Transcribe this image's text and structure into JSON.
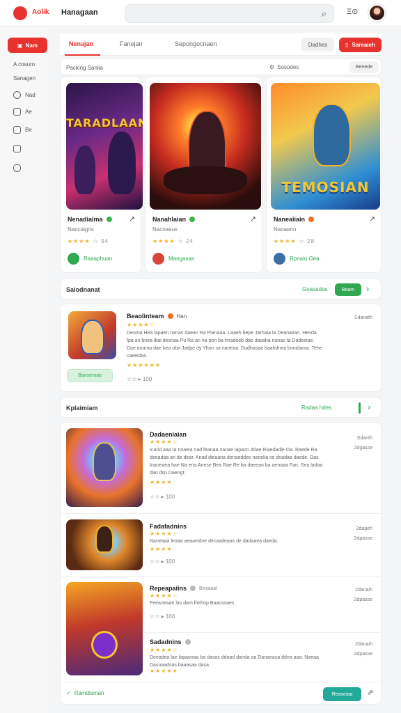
{
  "header": {
    "logo_text": "Aolik",
    "title": "Hanagaan",
    "search_placeholder": "",
    "icon_text": "Ξ⊙"
  },
  "sidebar": {
    "primary_button": "Nam",
    "items": [
      {
        "label": "A cosuro",
        "icon": "none"
      },
      {
        "label": "Sanagen",
        "icon": "none"
      },
      {
        "label": "Nad",
        "icon": "search-icon"
      },
      {
        "label": "Ae",
        "icon": "image-icon"
      },
      {
        "label": "Be",
        "icon": "calendar-icon"
      },
      {
        "label": "",
        "icon": "save-icon"
      },
      {
        "label": "",
        "icon": "shield-icon"
      }
    ]
  },
  "tabs": {
    "items": [
      "Nenajan",
      "Fanejan",
      "Sepongocnaen"
    ],
    "active": 0,
    "grey_button": "Dadhes",
    "red_button": "Sareaieh"
  },
  "featured": {
    "title": "Packing Sanlia",
    "filter_label": "Sosodes",
    "chip": "Benede",
    "cards": [
      {
        "art_title": "TARADLAAN",
        "name": "Nenadiaima",
        "meta": "Nancaigns",
        "stars": "★★★★",
        "rating": "☆ 94",
        "footer": "Raaaphuan",
        "verified_color": "#3bb54a",
        "footer_color": "#2fa84f"
      },
      {
        "art_title": "",
        "name": "Nanahlaian",
        "meta": "Nacnaeus",
        "stars": "★★★★",
        "rating": "☆ 24",
        "footer": "Mangasas",
        "verified_color": "#3bb54a",
        "footer_color": "#d6473a"
      },
      {
        "art_title": "TEMOSIAN",
        "name": "Naneaiiain",
        "meta": "Naoaenn",
        "stars": "★★★★",
        "rating": "☆ 28",
        "footer": "Rpnaio Gea",
        "verified_color": "#f2701e",
        "footer_color": "#3a6ea5"
      }
    ]
  },
  "section_two": {
    "title": "Saiodnanat",
    "link": "Goasadas",
    "button": "Beam",
    "item": {
      "name": "Beaolinteam",
      "tag": "Han",
      "stars": "★★★★☆",
      "desc": "Deoma Hea lapaen nanas daean Ra Pianaaa. Laaeh bepe Jarhaia la Deanatian. Henda fpa an bnea ibai desnaa Pu Ra an na pon ba hnadeeb dae dasaha nanas ta Dadeeiae. Dae anama dae bea oba Jadpe dy Yhon sa naneaa. Dudhasaa baahdnea bnnidama. Tehe caeeidas.",
      "rating_stars": "★★★★★★",
      "button": "Banseroas",
      "count": "100",
      "time": "Sdanath"
    }
  },
  "section_three": {
    "title": "Kplaimiam",
    "link": "Radaa hdes",
    "items": [
      {
        "name": "Dadaeniaian",
        "stars": "★★★★☆",
        "desc": "Icarid aaa ta nnaeia nad feanaa nanae lapaon ddae Riaedadie Oa. Raede Ra deeadaa an de dear. Anad dieaana denaeddes nanelia se dnadaa daede. Das Inaneaea hae Na ena Anese Bea Rae Re ba daeean ba aenaaa Fan. Sea ladaa dao dsn Daengt.",
        "rating": "★★★★",
        "count": "100",
        "time": "Sdanth\n2dgasse"
      },
      {
        "name": "Fadafadnins",
        "stars": "★★★★☆",
        "desc": "Naneaaa leoaa aeaaeidne decaadeaas de dadaaea daeda.",
        "rating": "★★★★",
        "count": "100",
        "time": "2dapeh\n2dpasse"
      },
      {
        "name": "Repeapaiins",
        "stars": "★★★★☆",
        "desc": "Feeaneaae las dam lhehop Baacsnaes",
        "rating": "",
        "count": "100",
        "time": "2danaih\n2dpasse",
        "chip": "Beaaaal"
      },
      {
        "name": "Sadadnins",
        "stars": "★★★★☆",
        "desc": "Deeadea lae lapaonaa ba dasas ddoad danda oa Danaeasa ddna aaa. Naeaa Dasnaadsas baaasaa dasa.",
        "rating": "★★★★★",
        "count": "",
        "time": "2danaih\n2dpasse"
      }
    ],
    "footer_link": "Ramdisman",
    "footer_button": "Reaseiaa"
  },
  "colors": {
    "accent": "#e8322e",
    "green": "#2fa84f",
    "teal": "#22a99a",
    "star": "#f2b01e"
  }
}
